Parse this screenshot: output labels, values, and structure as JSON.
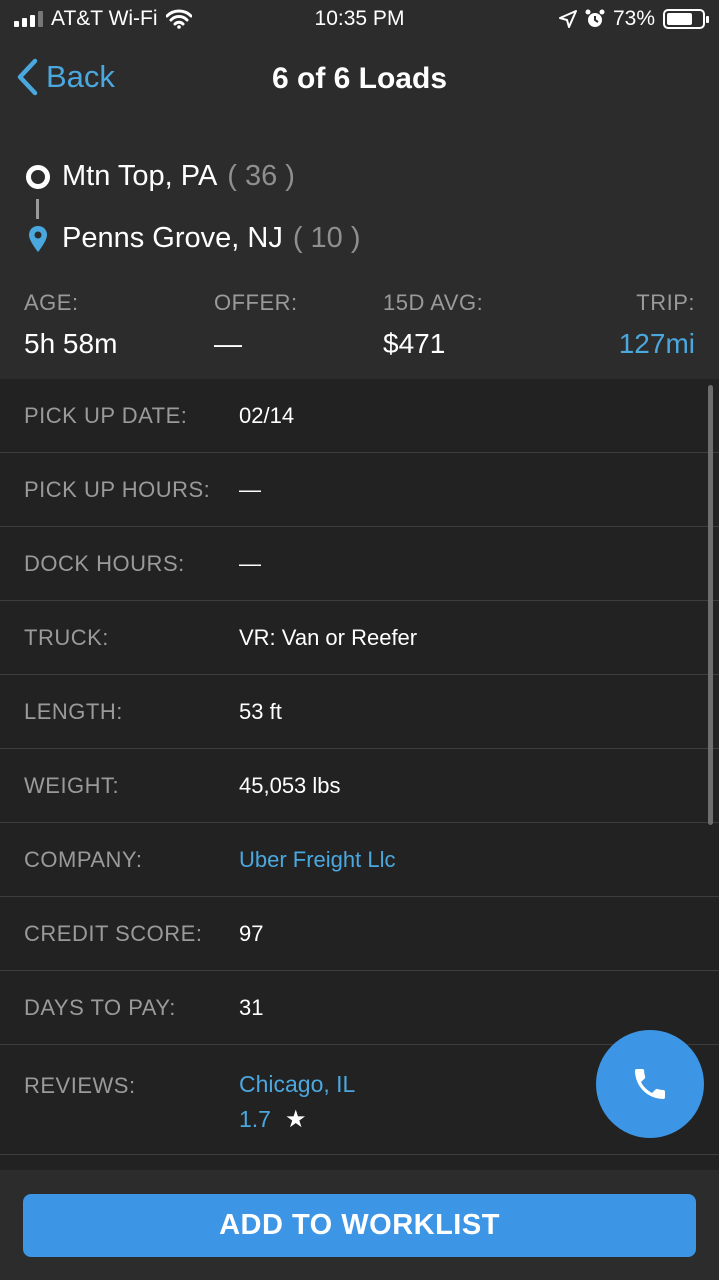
{
  "status_bar": {
    "carrier": "AT&T Wi-Fi",
    "time": "10:35 PM",
    "battery": "73%",
    "battery_level": 0.73,
    "icons": [
      "signal-icon",
      "wifi-icon",
      "location-arrow-icon",
      "alarm-icon",
      "battery-icon"
    ]
  },
  "nav": {
    "back_label": "Back",
    "title": "6 of 6 Loads"
  },
  "route": {
    "origin": {
      "city": "Mtn Top, PA",
      "count": "( 36 )"
    },
    "destination": {
      "city": "Penns Grove, NJ",
      "count": "( 10 )"
    }
  },
  "stats": {
    "age": {
      "label": "AGE:",
      "value": "5h 58m"
    },
    "offer": {
      "label": "OFFER:",
      "value": "—"
    },
    "avg": {
      "label": "15D AVG:",
      "value": "$471"
    },
    "trip": {
      "label": "TRIP:",
      "value": "127mi"
    }
  },
  "details": {
    "pickup_date": {
      "label": "PICK UP DATE:",
      "value": "02/14"
    },
    "pickup_hours": {
      "label": "PICK UP HOURS:",
      "value": "—"
    },
    "dock_hours": {
      "label": "DOCK HOURS:",
      "value": "—"
    },
    "truck": {
      "label": "TRUCK:",
      "value": "VR: Van or Reefer"
    },
    "length": {
      "label": "LENGTH:",
      "value": "53 ft"
    },
    "weight": {
      "label": "WEIGHT:",
      "value": "45,053 lbs"
    },
    "company": {
      "label": "COMPANY:",
      "value": "Uber Freight Llc"
    },
    "credit_score": {
      "label": "CREDIT SCORE:",
      "value": "97"
    },
    "days_to_pay": {
      "label": "DAYS TO PAY:",
      "value": "31"
    },
    "reviews": {
      "label": "REVIEWS:",
      "location": "Chicago, IL",
      "rating": "1.7",
      "star": "★"
    }
  },
  "actions": {
    "add_label": "ADD TO WORKLIST"
  },
  "colors": {
    "accent": "#4ba8df",
    "button": "#3d95e5",
    "background": "#222222",
    "panel": "#2c2c2c"
  }
}
